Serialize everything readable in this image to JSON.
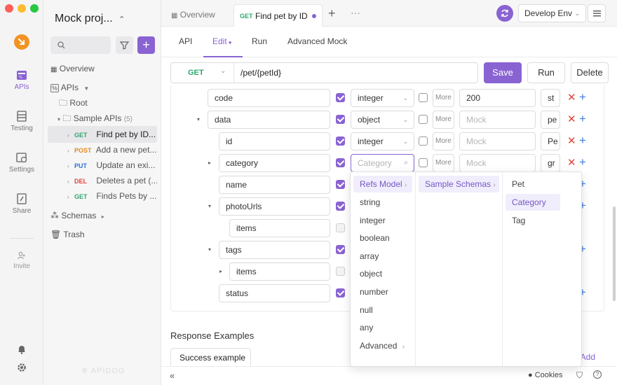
{
  "colors": {
    "accent": "#8a63d2",
    "get": "#2ea86b",
    "post": "#e08a1e",
    "put": "#2f73d6",
    "del": "#e2433a",
    "logo": "#f39323"
  },
  "rail": {
    "items": [
      {
        "label": "APIs",
        "icon": "api-icon"
      },
      {
        "label": "Testing",
        "icon": "testing-icon"
      },
      {
        "label": "Settings",
        "icon": "settings-icon"
      },
      {
        "label": "Share",
        "icon": "share-icon"
      },
      {
        "label": "Invite",
        "icon": "invite-icon"
      }
    ]
  },
  "sidebar": {
    "project_name": "Mock proj...",
    "overview": "Overview",
    "apis": "APIs",
    "root": "Root",
    "folder": "Sample APIs",
    "folder_count": "(5)",
    "endpoints": [
      {
        "method": "GET",
        "name": "Find pet by ID..."
      },
      {
        "method": "POST",
        "name": "Add a new pet..."
      },
      {
        "method": "PUT",
        "name": "Update an exi..."
      },
      {
        "method": "DEL",
        "name": "Deletes a pet (..."
      },
      {
        "method": "GET",
        "name": "Finds Pets by ..."
      }
    ],
    "schemas": "Schemas",
    "trash": "Trash",
    "watermark": "APIDOG"
  },
  "topbar": {
    "tabs": [
      {
        "label": "Overview"
      },
      {
        "method": "GET",
        "label": "Find pet by ID"
      }
    ],
    "env": "Develop Env"
  },
  "subtabs": [
    "API",
    "Edit",
    "Run",
    "Advanced Mock"
  ],
  "request": {
    "method": "GET",
    "path": "/pet/{petId}",
    "save": "Save",
    "run": "Run",
    "delete": "Delete"
  },
  "schema_rows": [
    {
      "name": "code",
      "type": "integer",
      "more": "More",
      "mock": "200",
      "extra": "st"
    },
    {
      "name": "data",
      "type": "object",
      "more": "More",
      "mock": "Mock",
      "extra": "pe"
    },
    {
      "name": "id",
      "type": "integer",
      "more": "More",
      "mock": "Mock",
      "extra": "Pe"
    },
    {
      "name": "category",
      "type": "Category",
      "more": "More",
      "mock": "Mock",
      "extra": "gr"
    },
    {
      "name": "name"
    },
    {
      "name": "photoUrls"
    },
    {
      "name": "items"
    },
    {
      "name": "tags"
    },
    {
      "name": "items"
    },
    {
      "name": "status"
    }
  ],
  "dropdown": {
    "col1": [
      "Refs Model",
      "string",
      "integer",
      "boolean",
      "array",
      "object",
      "number",
      "null",
      "any",
      "Advanced"
    ],
    "col2": [
      "Sample Schemas"
    ],
    "col3": [
      "Pet",
      "Category",
      "Tag"
    ]
  },
  "response": {
    "title": "Response Examples",
    "tab": "Success example",
    "add": "+ Add"
  },
  "footer": {
    "cookies": "Cookies"
  }
}
